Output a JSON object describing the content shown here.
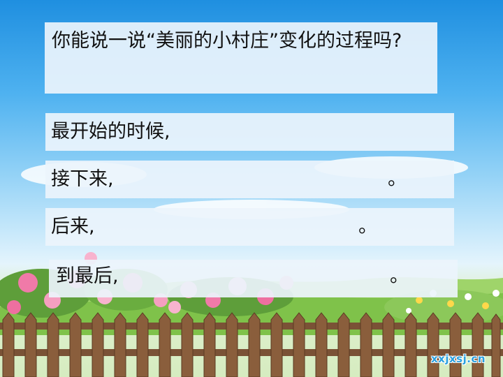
{
  "question": "你能说一说“美丽的小村庄”变化的过程吗?",
  "prompts": [
    {
      "text": "最开始的时候,",
      "end": ""
    },
    {
      "text": "接下来,",
      "end": "。"
    },
    {
      "text": "后来,",
      "end": "。"
    },
    {
      "text": "到最后,",
      "end": "。"
    }
  ],
  "watermark": "xxjxsj.cn",
  "colors": {
    "sky_top": "#1f8fe0",
    "box_bg": "#ebf4fc",
    "fence": "#7a5236",
    "flower_pink": "#f07aa8",
    "grass": "#7fc24a"
  }
}
